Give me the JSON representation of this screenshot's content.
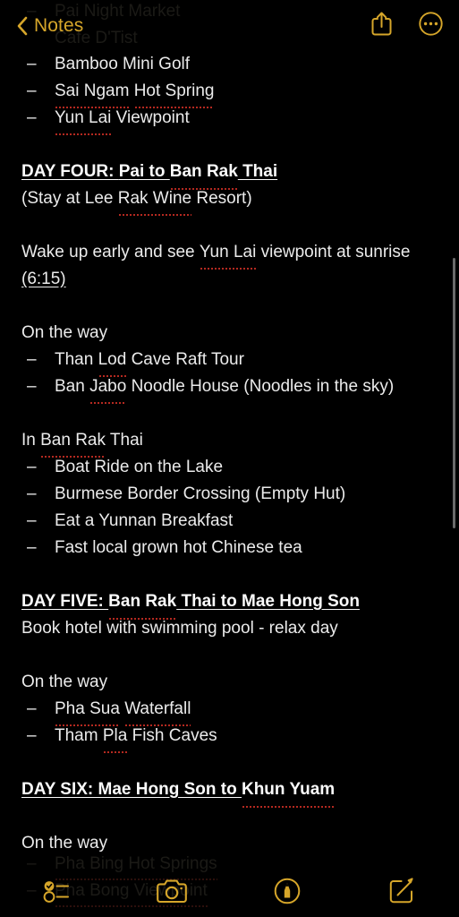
{
  "app": "Notes",
  "colors": {
    "accent": "#d6a62a",
    "background": "#000000",
    "text": "#ebebeb",
    "heading": "#fbfbfb",
    "spellcheck": "#f0372b",
    "scrollbar": "#6a6a6a",
    "ghost_text": "#1b1a16"
  },
  "navbar": {
    "back_label": "Notes",
    "back_icon": "chevron-left-icon",
    "share_icon": "share-icon",
    "more_icon": "more-circle-icon"
  },
  "ghost_top": [
    {
      "dash": "–",
      "text": "Pai Night Market"
    },
    {
      "dash": "",
      "text": "Cafe D'Tist"
    }
  ],
  "ghost_bottom": [
    {
      "dash": "–",
      "text": "Pha Bing Hot Springs",
      "misspelled": true
    },
    {
      "dash": "–",
      "text": "Pha Bong Viewpoint",
      "misspelled": true
    }
  ],
  "note": {
    "blocks": [
      {
        "type": "bullet",
        "dash": "–",
        "parts": [
          {
            "t": "Bamboo Mini Golf"
          }
        ]
      },
      {
        "type": "bullet",
        "dash": "–",
        "parts": [
          {
            "t": "Sai Ngam",
            "sp": true
          },
          {
            "t": " "
          },
          {
            "t": "Hot Spring",
            "sp": true
          }
        ]
      },
      {
        "type": "bullet",
        "dash": "–",
        "parts": [
          {
            "t": "Yun Lai",
            "sp": true
          },
          {
            "t": " Viewpoint"
          }
        ]
      },
      {
        "type": "spacer"
      },
      {
        "type": "heading",
        "parts": [
          {
            "t": "DAY FOUR: "
          },
          {
            "t": "Pai to "
          },
          {
            "t": "Ban Rak",
            "sp": true
          },
          {
            "t": " Thai"
          }
        ]
      },
      {
        "type": "text",
        "parts": [
          {
            "t": "(Stay at Lee "
          },
          {
            "t": "Rak Wine",
            "sp": true
          },
          {
            "t": " Resort)"
          }
        ]
      },
      {
        "type": "spacer"
      },
      {
        "type": "text",
        "parts": [
          {
            "t": "Wake up early and see "
          },
          {
            "t": "Yun Lai",
            "sp": true
          },
          {
            "t": " viewpoint at sunrise"
          }
        ]
      },
      {
        "type": "text",
        "parts": [
          {
            "t": "(6:15)",
            "ul": true
          }
        ]
      },
      {
        "type": "spacer"
      },
      {
        "type": "text",
        "parts": [
          {
            "t": "On the way"
          }
        ]
      },
      {
        "type": "bullet",
        "dash": "–",
        "parts": [
          {
            "t": "Than "
          },
          {
            "t": "Lod",
            "sp": true
          },
          {
            "t": " Cave Raft Tour"
          }
        ]
      },
      {
        "type": "bullet",
        "dash": "–",
        "parts": [
          {
            "t": "Ban "
          },
          {
            "t": "Jabo",
            "sp": true
          },
          {
            "t": " Noodle House (Noodles in the sky)"
          }
        ]
      },
      {
        "type": "spacer"
      },
      {
        "type": "text",
        "parts": [
          {
            "t": "In "
          },
          {
            "t": "Ban Rak",
            "sp": true
          },
          {
            "t": " Thai"
          }
        ]
      },
      {
        "type": "bullet",
        "dash": "–",
        "parts": [
          {
            "t": "Boat Ride on the Lake"
          }
        ]
      },
      {
        "type": "bullet",
        "dash": "–",
        "parts": [
          {
            "t": "Burmese Border Crossing (Empty Hut)"
          }
        ]
      },
      {
        "type": "bullet",
        "dash": "–",
        "parts": [
          {
            "t": "Eat a Yunnan Breakfast"
          }
        ]
      },
      {
        "type": "bullet",
        "dash": "–",
        "parts": [
          {
            "t": "Fast local grown hot Chinese tea"
          }
        ]
      },
      {
        "type": "spacer"
      },
      {
        "type": "heading",
        "parts": [
          {
            "t": "DAY FIVE: "
          },
          {
            "t": "Ban Rak",
            "sp": true
          },
          {
            "t": " Thai to Mae Hong Son"
          }
        ]
      },
      {
        "type": "text",
        "parts": [
          {
            "t": "Book hotel with swimming pool - relax day"
          }
        ]
      },
      {
        "type": "spacer"
      },
      {
        "type": "text",
        "parts": [
          {
            "t": "On the way"
          }
        ]
      },
      {
        "type": "bullet",
        "dash": "–",
        "parts": [
          {
            "t": "Pha Sua",
            "sp": true
          },
          {
            "t": " "
          },
          {
            "t": "Waterfall",
            "sp": true
          }
        ]
      },
      {
        "type": "bullet",
        "dash": "–",
        "parts": [
          {
            "t": "Tham "
          },
          {
            "t": "Pla",
            "sp": true
          },
          {
            "t": " Fish Caves"
          }
        ]
      },
      {
        "type": "spacer"
      },
      {
        "type": "heading",
        "parts": [
          {
            "t": "DAY SIX: Mae Hong Son to "
          },
          {
            "t": "Khun Yuam",
            "sp": true
          }
        ]
      },
      {
        "type": "spacer"
      },
      {
        "type": "text",
        "parts": [
          {
            "t": "On the way"
          }
        ]
      }
    ]
  },
  "toolbar": {
    "items": [
      {
        "icon": "checklist-icon",
        "name": "checklist-button"
      },
      {
        "icon": "camera-icon",
        "name": "camera-button"
      },
      {
        "icon": "markup-pen-icon",
        "name": "markup-button"
      },
      {
        "icon": "compose-icon",
        "name": "compose-button"
      }
    ]
  }
}
